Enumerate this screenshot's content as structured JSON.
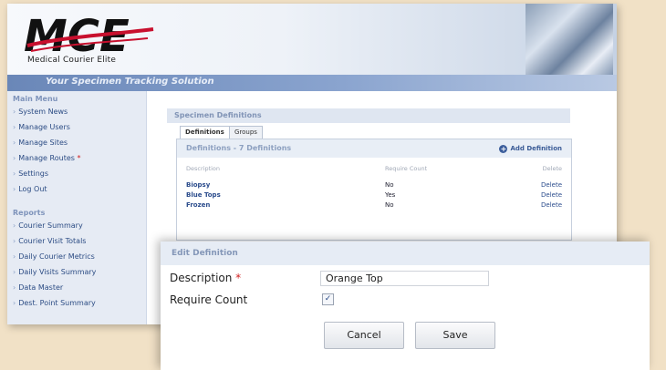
{
  "app": {
    "logo_text": "MCE",
    "logo_subtitle": "Medical Courier Elite",
    "tagline": "Your Specimen Tracking Solution"
  },
  "sidebar": {
    "main_menu_title": "Main Menu",
    "main_items": [
      "System News",
      "Manage Users",
      "Manage Sites",
      "Manage Routes",
      "Settings",
      "Log Out"
    ],
    "reports_title": "Reports",
    "report_items": [
      "Courier Summary",
      "Courier Visit Totals",
      "Daily Courier Metrics",
      "Daily Visits Summary",
      "Data Master",
      "Dest. Point Summary"
    ]
  },
  "main": {
    "panel_title": "Specimen Definitions",
    "tabs": [
      "Definitions",
      "Groups"
    ],
    "definitions_header": "Definitions - 7 Definitions",
    "add_definition_label": "Add Definition",
    "columns": {
      "description": "Description",
      "require_count": "Require Count",
      "delete": "Delete"
    },
    "rows": [
      {
        "description": "Biopsy",
        "require_count": "No",
        "delete": "Delete"
      },
      {
        "description": "Blue Tops",
        "require_count": "Yes",
        "delete": "Delete"
      },
      {
        "description": "Frozen",
        "require_count": "No",
        "delete": "Delete"
      }
    ]
  },
  "dialog": {
    "title": "Edit Definition",
    "description_label": "Description",
    "required_marker": "*",
    "description_value": "Orange Top",
    "require_count_label": "Require Count",
    "require_count_checked": true,
    "checkmark": "✓",
    "cancel_label": "Cancel",
    "save_label": "Save"
  },
  "colors": {
    "background": "#f1e1c6",
    "accent": "#6a87b8",
    "link": "#2b4c8c",
    "required": "#d02020"
  }
}
